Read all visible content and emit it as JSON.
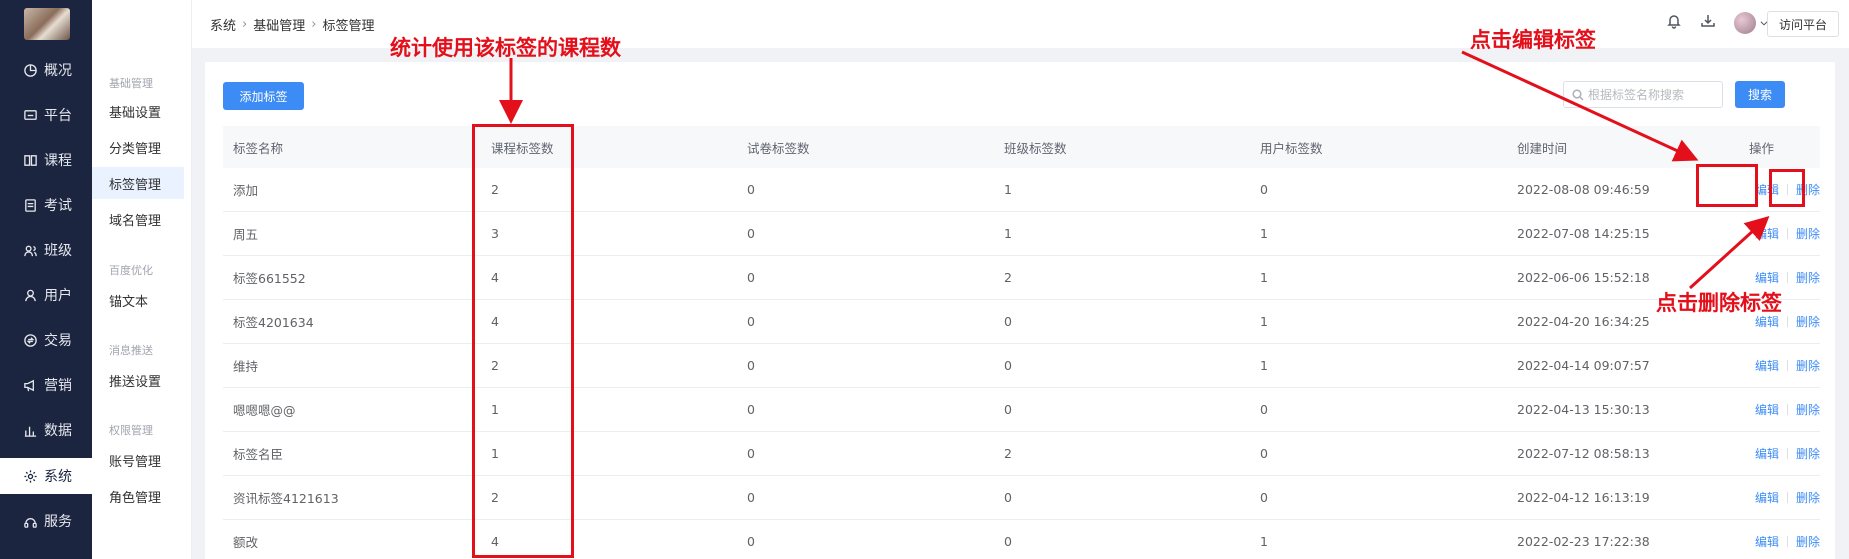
{
  "nav": {
    "items": [
      {
        "label": "概况",
        "icon": "overview-icon"
      },
      {
        "label": "平台",
        "icon": "platform-icon"
      },
      {
        "label": "课程",
        "icon": "course-icon"
      },
      {
        "label": "考试",
        "icon": "exam-icon"
      },
      {
        "label": "班级",
        "icon": "class-icon"
      },
      {
        "label": "用户",
        "icon": "user-icon"
      },
      {
        "label": "交易",
        "icon": "trade-icon"
      },
      {
        "label": "营销",
        "icon": "marketing-icon"
      },
      {
        "label": "数据",
        "icon": "data-icon"
      },
      {
        "label": "系统",
        "icon": "system-icon",
        "active": true
      },
      {
        "label": "服务",
        "icon": "service-icon"
      }
    ]
  },
  "submenu": {
    "group1": "基础管理",
    "base_settings": "基础设置",
    "category_mgmt": "分类管理",
    "tag_mgmt": "标签管理",
    "domain_mgmt": "域名管理",
    "group2": "百度优化",
    "anchor_text": "锚文本",
    "group3": "消息推送",
    "push_settings": "推送设置",
    "group4": "权限管理",
    "account_mgmt": "账号管理",
    "role_mgmt": "角色管理"
  },
  "header": {
    "breadcrumb": [
      "系统",
      "基础管理",
      "标签管理"
    ],
    "visit_label": "访问平台"
  },
  "toolbar": {
    "add_label": "添加标签",
    "search_placeholder": "根据标签名称搜索",
    "search_label": "搜索"
  },
  "table": {
    "headers": [
      "标签名称",
      "课程标签数",
      "试卷标签数",
      "班级标签数",
      "用户标签数",
      "创建时间",
      "操作"
    ],
    "edit_label": "编辑",
    "delete_label": "删除",
    "rows": [
      {
        "name": "添加",
        "course": "2",
        "paper": "0",
        "cls": "1",
        "user": "0",
        "time": "2022-08-08 09:46:59"
      },
      {
        "name": "周五",
        "course": "3",
        "paper": "0",
        "cls": "1",
        "user": "1",
        "time": "2022-07-08 14:25:15"
      },
      {
        "name": "标签661552",
        "course": "4",
        "paper": "0",
        "cls": "2",
        "user": "1",
        "time": "2022-06-06 15:52:18"
      },
      {
        "name": "标签4201634",
        "course": "4",
        "paper": "0",
        "cls": "0",
        "user": "1",
        "time": "2022-04-20 16:34:25"
      },
      {
        "name": "维持",
        "course": "2",
        "paper": "0",
        "cls": "0",
        "user": "1",
        "time": "2022-04-14 09:07:57"
      },
      {
        "name": "嗯嗯嗯@@",
        "course": "1",
        "paper": "0",
        "cls": "0",
        "user": "0",
        "time": "2022-04-13 15:30:13"
      },
      {
        "name": "标签名臣",
        "course": "1",
        "paper": "0",
        "cls": "2",
        "user": "0",
        "time": "2022-07-12 08:58:13"
      },
      {
        "name": "资讯标签4121613",
        "course": "2",
        "paper": "0",
        "cls": "0",
        "user": "0",
        "time": "2022-04-12 16:13:19"
      },
      {
        "name": "额改",
        "course": "4",
        "paper": "0",
        "cls": "0",
        "user": "1",
        "time": "2022-02-23 17:22:38"
      }
    ]
  },
  "annotations": {
    "course_count_note": "统计使用该标签的课程数",
    "edit_note": "点击编辑标签",
    "delete_note": "点击删除标签",
    "color": "#e3101b"
  }
}
